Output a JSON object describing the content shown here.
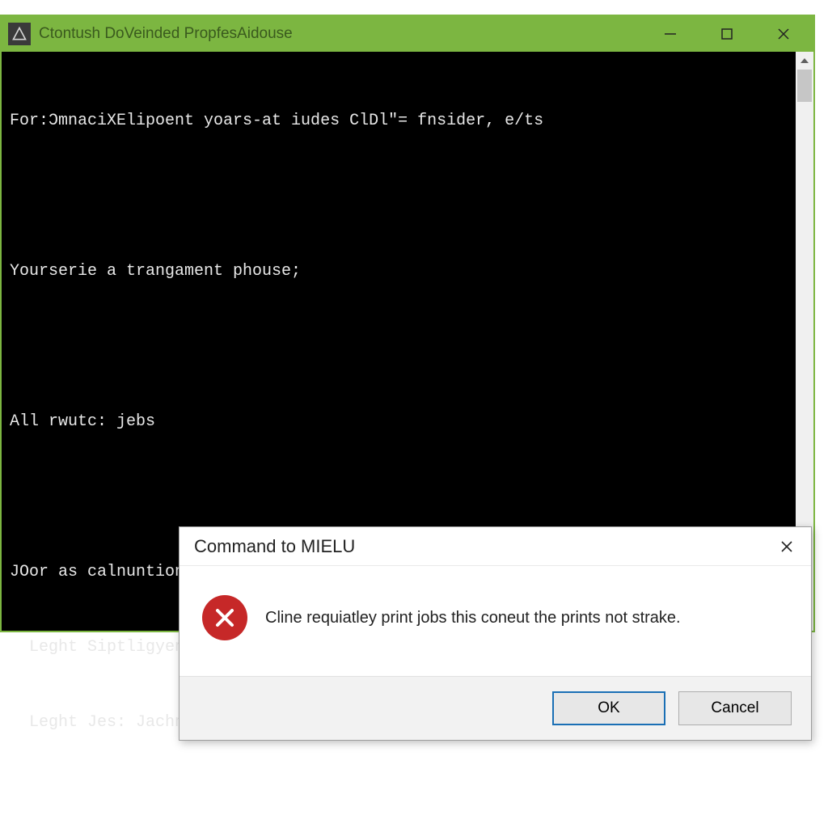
{
  "terminal": {
    "title": "Ctontush DoVeinded PropfesAidouse",
    "lines": [
      "For:ƆmnaciXElipoent yoars-at iudes ClDl\"= fnsider, e/ts",
      "",
      "Yourserie a trangament phouse;",
      "",
      "All rwutc: jebs",
      "",
      "JOor as calnuntion cansed gardy the cansed sclp:",
      "  Leght Siptligyent, Ercl),2, 1,,Tfttering to",
      "  Leght Jes: Jachniby Sichimere "
    ]
  },
  "dialog": {
    "title": "Command to MIELU",
    "message": "Cline requiatley print jobs this coneut the prints not strake.",
    "ok_label": "OK",
    "cancel_label": "Cancel"
  },
  "colors": {
    "titlebar": "#7cb641",
    "error": "#c62828",
    "dialog_primary_border": "#1a6fb5"
  }
}
